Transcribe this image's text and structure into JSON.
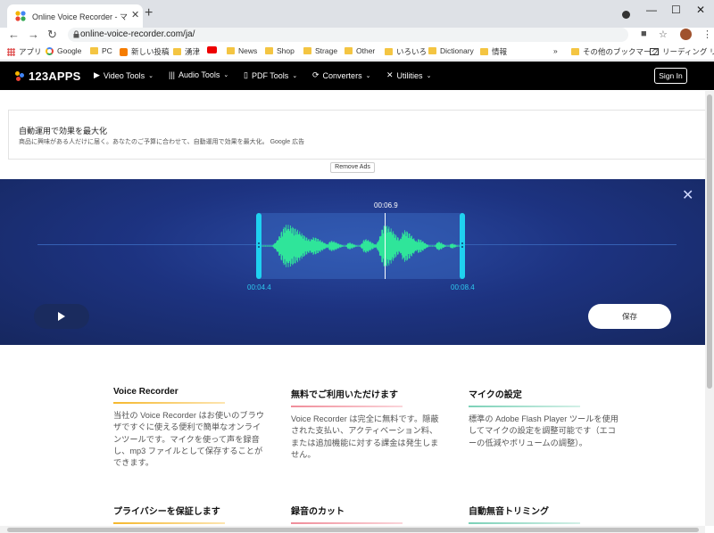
{
  "browser": {
    "tab_title": "Online Voice Recorder - マイクから",
    "url": "online-voice-recorder.com/ja/",
    "bookmarks": [
      "アプリ",
      "Google",
      "PC",
      "新しい投稿",
      "湧津",
      "News",
      "Shop",
      "Strage",
      "Other",
      "いろいろ",
      "Dictionary",
      "情報"
    ],
    "bookmarks_more": "»",
    "other_bookmarks": "その他のブックマーク",
    "reading_list": "リーディング リスト"
  },
  "site": {
    "logo": "123APPS",
    "menu": [
      "Video Tools",
      "Audio Tools",
      "PDF Tools",
      "Converters",
      "Utilities"
    ],
    "sign_in": "Sign In"
  },
  "ad": {
    "headline": "自動運用で効果を最大化",
    "body": "商品に興味がある人だけに届く。あなたのご予算に合わせて、自動運用で効果を最大化。 Google 広告",
    "remove_ads": "Remove Ads"
  },
  "recorder": {
    "current_time": "00:06.9",
    "start_time": "00:04.4",
    "end_time": "00:08.4",
    "save_label": "保存",
    "playhead_fraction": 0.62,
    "accent_color": "#1fd1f0",
    "wave_color": "#2fe59a"
  },
  "features": [
    {
      "title": "Voice Recorder",
      "text": "当社の Voice Recorder はお使いのブラウザですぐに使える便利で簡単なオンラインツールです。マイクを使って声を録音し、mp3 ファイルとして保存することができます。",
      "bar_color": "#f5b82e"
    },
    {
      "title": "無料でご利用いただけます",
      "text": "Voice Recorder は完全に無料です。隠蔽された支払い、アクティベーション料、または追加機能に対する課金は発生しません。",
      "bar_color": "#f08d9a"
    },
    {
      "title": "マイクの設定",
      "text": "標準の Adobe Flash Player ツールを使用してマイクの設定を調整可能です（エコーの低減やボリュームの調整）。",
      "bar_color": "#7cd1b8"
    }
  ],
  "features_row2": [
    {
      "title": "プライバシーを保証します",
      "bar_color": "#f5b82e"
    },
    {
      "title": "録音のカット",
      "bar_color": "#f08d9a"
    },
    {
      "title": "自動無音トリミング",
      "bar_color": "#7cd1b8"
    }
  ]
}
